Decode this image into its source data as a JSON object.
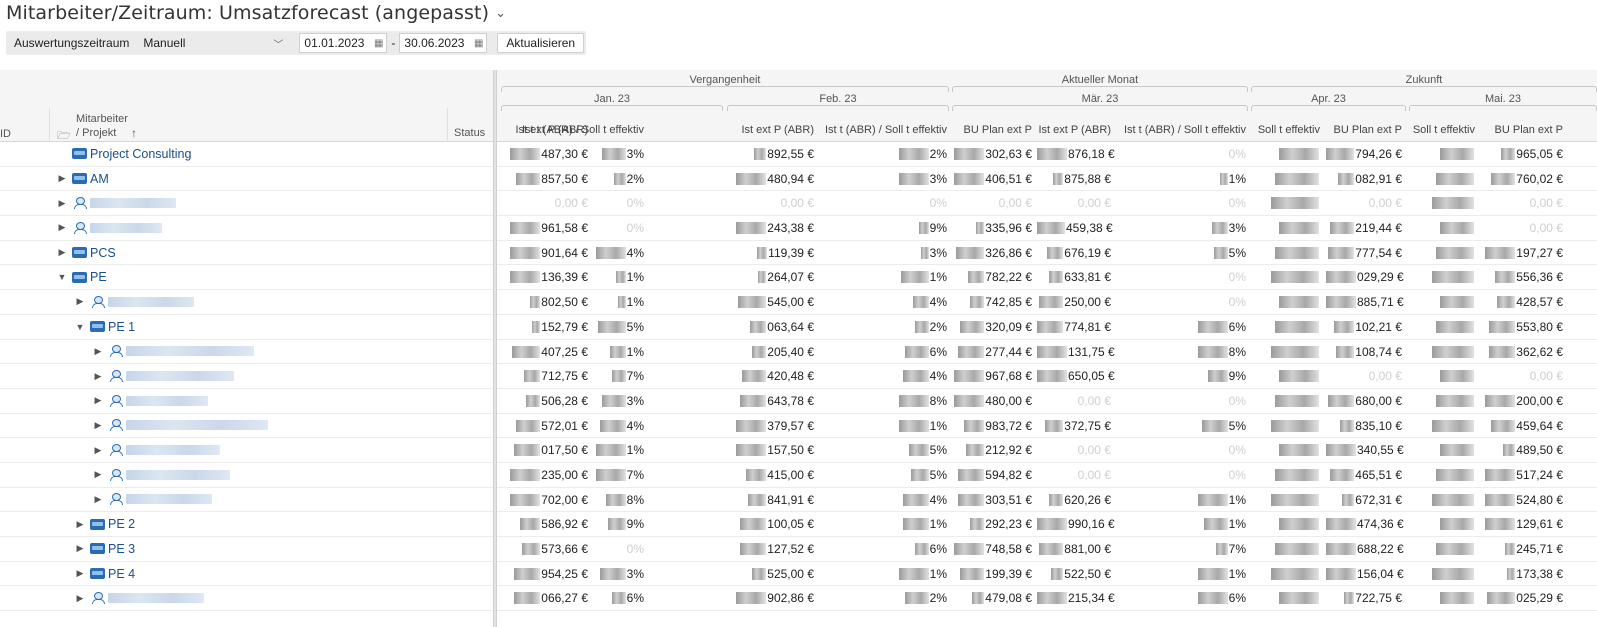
{
  "header": {
    "title": "Mitarbeiter/Zeitraum: Umsatzforecast (angepasst)"
  },
  "toolbar": {
    "period_label": "Auswertungszeitraum",
    "mode": "Manuell",
    "date_from": "01.01.2023",
    "date_to": "30.06.2023",
    "dash": "-",
    "refresh": "Aktualisieren"
  },
  "grid": {
    "left_headers": {
      "id": "ID",
      "employee_line1": "Mitarbeiter",
      "employee_line2": "/ Projekt",
      "status": "Status"
    },
    "groups": [
      "Vergangenheit",
      "Aktueller Monat",
      "Zukunft"
    ],
    "months": [
      "Jan. 23",
      "Feb. 23",
      "Mär. 23",
      "Apr. 23",
      "Mai. 23"
    ],
    "columns": [
      "Ist ext P (ABR)",
      "Ist t (ABR) / Soll t effektiv",
      "Ist ext P (ABR)",
      "Ist t (ABR) / Soll t effektiv",
      "BU Plan ext P",
      "Ist ext P (ABR)",
      "Ist t (ABR) / Soll t effektiv",
      "Soll t effektiv",
      "BU Plan ext P",
      "Soll t effektiv",
      "BU Plan ext P"
    ],
    "rows": [
      {
        "name": "Project Consulting",
        "vals": [
          "487,30 €",
          "3%",
          "892,55 €",
          "2%",
          "302,63 €",
          "876,18 €",
          "0%",
          "",
          "794,26 €",
          "",
          "965,05 €"
        ]
      },
      {
        "name": "AM",
        "vals": [
          "857,50 €",
          "2%",
          "480,94 €",
          "3%",
          "406,51 €",
          "875,88 €",
          "1%",
          "",
          "082,91 €",
          "",
          "760,02 €"
        ]
      },
      {
        "name": "",
        "vals": [
          "0,00 €",
          "0%",
          "0,00 €",
          "0%",
          "0,00 €",
          "0,00 €",
          "0%",
          "",
          "0,00 €",
          "",
          "0,00 €"
        ]
      },
      {
        "name": "",
        "vals": [
          "961,58 €",
          "0%",
          "243,38 €",
          "9%",
          "335,96 €",
          "459,38 €",
          "3%",
          "",
          "219,44 €",
          "",
          "0,00 €"
        ]
      },
      {
        "name": "PCS",
        "vals": [
          "901,64 €",
          "4%",
          "119,39 €",
          "3%",
          "326,86 €",
          "676,19 €",
          "5%",
          "",
          "777,54 €",
          "",
          "197,27 €"
        ]
      },
      {
        "name": "PE",
        "vals": [
          "136,39 €",
          "1%",
          "264,07 €",
          "1%",
          "782,22 €",
          "633,81 €",
          "0%",
          "",
          "029,29 €",
          "",
          "556,36 €"
        ]
      },
      {
        "name": "",
        "vals": [
          "802,50 €",
          "1%",
          "545,00 €",
          "4%",
          "742,85 €",
          "250,00 €",
          "0%",
          "",
          "885,71 €",
          "",
          "428,57 €"
        ]
      },
      {
        "name": "PE 1",
        "vals": [
          "152,79 €",
          "5%",
          "063,64 €",
          "2%",
          "320,09 €",
          "774,81 €",
          "6%",
          "",
          "102,21 €",
          "",
          "553,80 €"
        ]
      },
      {
        "name": "",
        "vals": [
          "407,25 €",
          "1%",
          "205,40 €",
          "6%",
          "277,44 €",
          "131,75 €",
          "8%",
          "",
          "108,74 €",
          "",
          "362,62 €"
        ]
      },
      {
        "name": "",
        "vals": [
          "712,75 €",
          "7%",
          "420,48 €",
          "4%",
          "967,68 €",
          "650,05 €",
          "9%",
          "",
          "0,00 €",
          "",
          "0,00 €"
        ]
      },
      {
        "name": "",
        "vals": [
          "506,28 €",
          "3%",
          "643,78 €",
          "8%",
          "480,00 €",
          "0,00 €",
          "0%",
          "",
          "680,00 €",
          "",
          "200,00 €"
        ]
      },
      {
        "name": "",
        "vals": [
          "572,01 €",
          "4%",
          "379,57 €",
          "1%",
          "983,72 €",
          "372,75 €",
          "5%",
          "",
          "835,10 €",
          "",
          "459,64 €"
        ]
      },
      {
        "name": "",
        "vals": [
          "017,50 €",
          "1%",
          "157,50 €",
          "5%",
          "212,92 €",
          "0,00 €",
          "0%",
          "",
          "340,55 €",
          "",
          "489,50 €"
        ]
      },
      {
        "name": "",
        "vals": [
          "235,00 €",
          "7%",
          "415,00 €",
          "5%",
          "594,82 €",
          "0,00 €",
          "0%",
          "",
          "465,51 €",
          "",
          "517,24 €"
        ]
      },
      {
        "name": "",
        "vals": [
          "702,00 €",
          "8%",
          "841,91 €",
          "4%",
          "303,51 €",
          "620,26 €",
          "1%",
          "",
          "672,31 €",
          "",
          "524,80 €"
        ]
      },
      {
        "name": "PE 2",
        "vals": [
          "586,92 €",
          "9%",
          "100,05 €",
          "1%",
          "292,23 €",
          "990,16 €",
          "1%",
          "",
          "474,36 €",
          "",
          "129,61 €"
        ]
      },
      {
        "name": "PE 3",
        "vals": [
          "573,66 €",
          "0%",
          "127,52 €",
          "6%",
          "748,58 €",
          "881,00 €",
          "7%",
          "",
          "688,22 €",
          "",
          "245,71 €"
        ]
      },
      {
        "name": "PE 4",
        "vals": [
          "954,25 €",
          "3%",
          "525,00 €",
          "1%",
          "199,39 €",
          "522,50 €",
          "1%",
          "",
          "156,04 €",
          "",
          "173,38 €"
        ]
      },
      {
        "name": "",
        "vals": [
          "066,27 €",
          "6%",
          "902,86 €",
          "2%",
          "479,08 €",
          "215,34 €",
          "6%",
          "",
          "722,75 €",
          "",
          "025,29 €"
        ]
      }
    ]
  }
}
